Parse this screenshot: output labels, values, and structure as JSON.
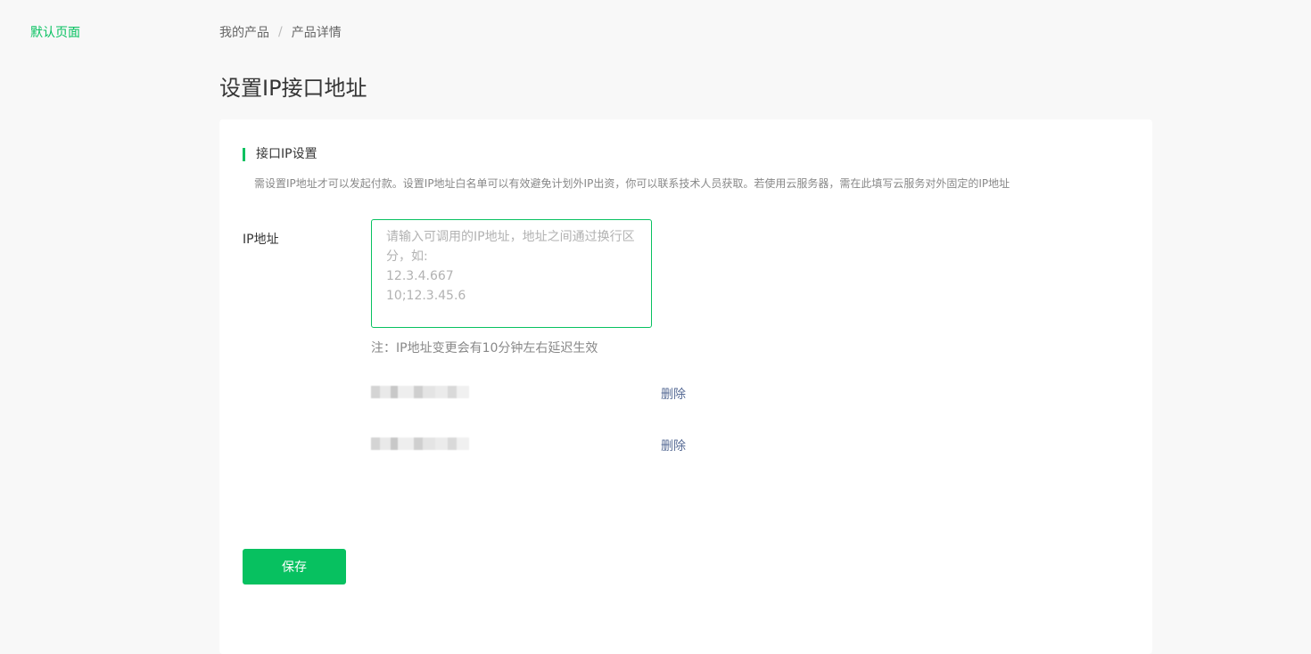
{
  "sidebar": {
    "items": [
      {
        "label": "默认页面"
      }
    ]
  },
  "breadcrumb": {
    "items": [
      {
        "label": "我的产品"
      },
      {
        "label": "产品详情"
      }
    ],
    "separator": "/"
  },
  "page": {
    "title": "设置IP接口地址"
  },
  "section": {
    "title": "接口IP设置",
    "description": "需设置IP地址才可以发起付款。设置IP地址白名单可以有效避免计划外IP出资，你可以联系技术人员获取。若使用云服务器，需在此填写云服务对外固定的IP地址"
  },
  "form": {
    "ip_label": "IP地址",
    "ip_placeholder": "请输入可调用的IP地址，地址之间通过换行区分，如:\n12.3.4.667\n10;12.3.45.6",
    "note": "注：IP地址变更会有10分钟左右延迟生效",
    "ip_list": [
      {
        "delete_label": "删除"
      },
      {
        "delete_label": "删除"
      }
    ],
    "save_label": "保存"
  },
  "colors": {
    "accent": "#07c160",
    "link": "#576b95",
    "background": "#f8f8f8"
  }
}
